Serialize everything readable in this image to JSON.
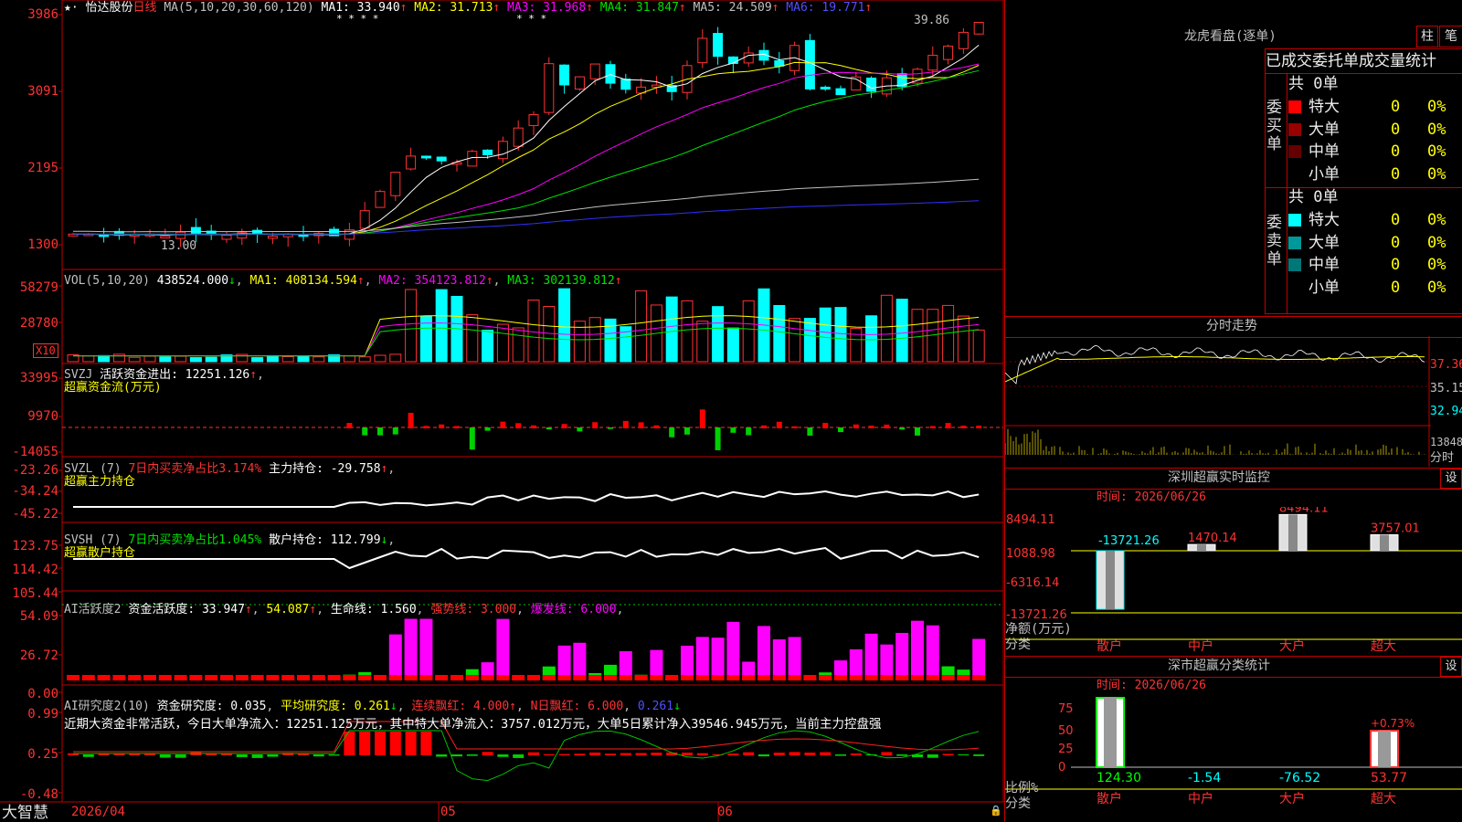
{
  "app": {
    "brand": "大智慧"
  },
  "header": {
    "stock_name": "怡达股份",
    "period": "日线",
    "ma_title": "MA(5,10,20,30,60,120)",
    "ma": [
      {
        "label": "MA1: 33.940",
        "arrow": "↑",
        "color": "#ffffff"
      },
      {
        "label": "MA2: 31.713",
        "arrow": "↑",
        "color": "#ffff00"
      },
      {
        "label": "MA3: 31.968",
        "arrow": "↑",
        "color": "#ff00ff"
      },
      {
        "label": "MA4: 31.847",
        "arrow": "↑",
        "color": "#00e000"
      },
      {
        "label": "MA5: 24.509",
        "arrow": "↑",
        "color": "#c0c0c0"
      },
      {
        "label": "MA6: 19.771",
        "arrow": "↑",
        "color": "#5050ff"
      }
    ],
    "stars": "* * * *",
    "stars2": "* * *"
  },
  "main_axis": [
    "3986",
    "3091",
    "2195",
    "1300"
  ],
  "annotations": {
    "high": "39.86",
    "low": "13.00"
  },
  "vol": {
    "title": "VOL(5,10,20)",
    "value": "438524.000",
    "arrow": "↓",
    "ma1": "MA1: 408134.594",
    "ma2": "MA2: 354123.812",
    "ma3": "MA3: 302139.812",
    "axis": [
      "58279",
      "28780"
    ],
    "unit": "X10"
  },
  "svzj": {
    "title": "SVZJ",
    "metric": "活跃资金进出: 12251.126",
    "arrow": "↑",
    "subtitle": "超赢资金流(万元)",
    "axis": [
      "33995",
      "9970",
      "-14055"
    ]
  },
  "svzl": {
    "title": "SVZL (7)",
    "metric1": "7日内买卖净占比3.174%",
    "metric2": "主力持仓: -29.758",
    "subtitle": "超赢主力持仓",
    "axis": [
      "-23.26",
      "-34.24",
      "-45.22"
    ]
  },
  "svsh": {
    "title": "SVSH (7)",
    "metric1": "7日内买卖净占比1.045%",
    "metric2": "散户持仓: 112.799",
    "subtitle": "超赢散户持仓",
    "axis": [
      "123.75",
      "114.42",
      "105.44"
    ]
  },
  "ai1": {
    "title": "AI活跃度2",
    "metric": "资金活跃度: 33.947",
    "v2": "54.087",
    "v3": "生命线: 1.560",
    "v4": "强势线: 3.000",
    "v5": "爆发线: 6.000",
    "axis": [
      "54.09",
      "26.72",
      "0.00"
    ]
  },
  "ai2": {
    "title": "AI研究度2(10)",
    "metric": "资金研究度: 0.035",
    "v2": "平均研究度: 0.261",
    "v3": "连续飘红: 4.000",
    "v4": "N日飘红: 6.000",
    "v5": "0.261",
    "axis": [
      "0.99",
      "0.25",
      "-0.48"
    ],
    "comment": "近期大资金非常活跃，今日大单净流入：12251.125万元，其中特大单净流入：3757.012万元，大单5日累计净入39546.945万元，当前主力控盘强"
  },
  "xaxis": [
    "2026/04",
    "05",
    "06"
  ],
  "lhb": {
    "title": "龙虎看盘(逐单)",
    "btn_bar": "柱",
    "btn_pen": "笔",
    "tabs": [
      "已成交",
      "委托单",
      "成交量统计"
    ],
    "buy_label": "委买单",
    "sell_label": "委卖单",
    "buy_total": "共 0单",
    "sell_total": "共 0单",
    "buy": [
      {
        "name": "特大",
        "count": "0",
        "pct": "0%",
        "color": "#ff0000"
      },
      {
        "name": "大单",
        "count": "0",
        "pct": "0%",
        "color": "#990000"
      },
      {
        "name": "中单",
        "count": "0",
        "pct": "0%",
        "color": "#660000"
      },
      {
        "name": "小单",
        "count": "0",
        "pct": "0%",
        "color": ""
      }
    ],
    "sell": [
      {
        "name": "特大",
        "count": "0",
        "pct": "0%",
        "color": "#00ffff"
      },
      {
        "name": "大单",
        "count": "0",
        "pct": "0%",
        "color": "#009999"
      },
      {
        "name": "中单",
        "count": "0",
        "pct": "0%",
        "color": "#007777"
      },
      {
        "name": "小单",
        "count": "0",
        "pct": "0%",
        "color": ""
      }
    ]
  },
  "intraday": {
    "title": "分时走势",
    "axis": [
      "37.36",
      "35.15",
      "32.94"
    ],
    "vol_label": "13848",
    "period": "分时"
  },
  "sz_monitor": {
    "title": "深圳超赢实时监控",
    "btn": "设",
    "time": "时间: 2026/06/26",
    "axis": [
      "8494.11",
      "1088.98",
      "-6316.14",
      "-13721.26"
    ],
    "bars": [
      {
        "cat": "散户",
        "value": "-13721.26"
      },
      {
        "cat": "中户",
        "value": "1470.14"
      },
      {
        "cat": "大户",
        "value": "8494.11"
      },
      {
        "cat": "超大",
        "value": "3757.01"
      }
    ],
    "side_label": "净额(万元)",
    "side_label2": "分类"
  },
  "sz_stats": {
    "title": "深市超赢分类统计",
    "btn": "设",
    "time": "时间: 2026/06/26",
    "axis": [
      "75",
      "50",
      "25",
      "0"
    ],
    "bars": [
      {
        "cat": "散户",
        "value": "124.30",
        "top": ""
      },
      {
        "cat": "中户",
        "value": "-1.54",
        "top": ""
      },
      {
        "cat": "大户",
        "value": "-76.52",
        "top": ""
      },
      {
        "cat": "超大",
        "value": "53.77",
        "top": "+0.73%"
      }
    ],
    "side_label": "比例%",
    "side_label2": "分类"
  }
}
